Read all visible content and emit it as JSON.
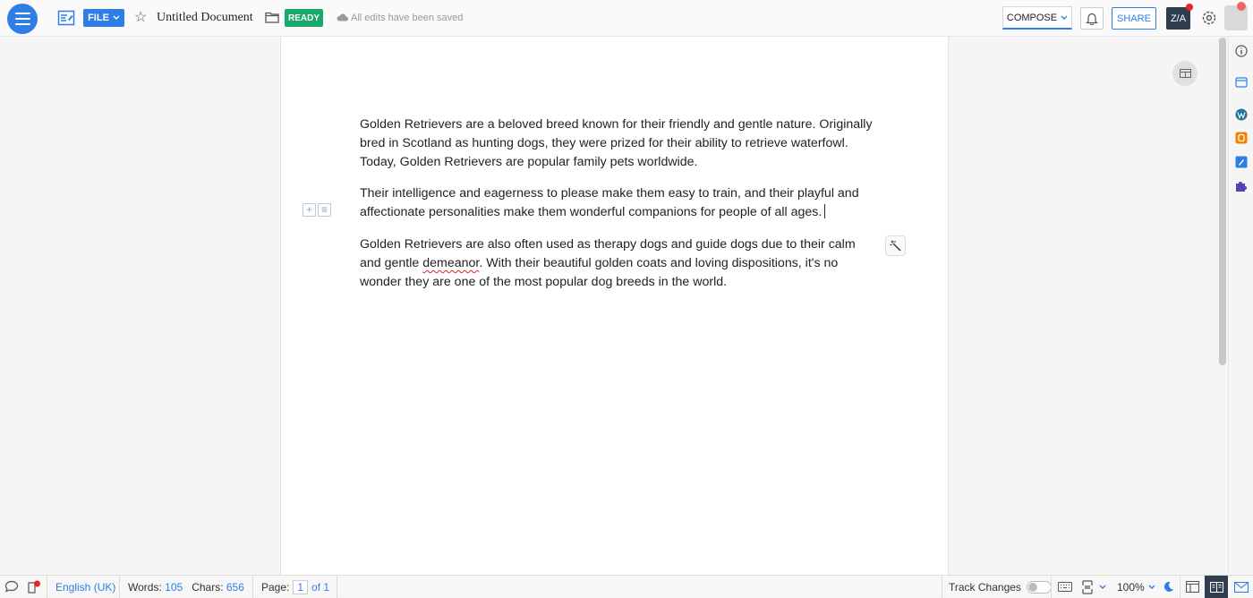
{
  "header": {
    "file_label": "FILE",
    "doc_title": "Untitled Document",
    "status_badge": "READY",
    "save_status": "All edits have been saved",
    "compose_label": "COMPOSE",
    "share_label": "SHARE",
    "translate_label": "Z/A"
  },
  "document": {
    "paragraphs": [
      "Golden Retrievers are a beloved breed known for their friendly and gentle nature. Originally bred in Scotland as hunting dogs, they were prized for their ability to retrieve waterfowl. Today, Golden Retrievers are popular family pets worldwide.",
      "Their intelligence and eagerness to please make them easy to train, and their playful and affectionate personalities make them wonderful companions for people of all ages."
    ],
    "p3_before": "Golden Retrievers are also often used as therapy dogs and guide dogs due to their calm and gentle ",
    "p3_misspelled": "demeanor",
    "p3_after": ". With their beautiful golden coats and loving dispositions, it's no wonder they are one of the most popular dog breeds in the world."
  },
  "statusbar": {
    "language": "English (UK)",
    "words_label": "Words:",
    "words_value": "105",
    "chars_label": "Chars:",
    "chars_value": "656",
    "page_label": "Page:",
    "page_current": "1",
    "page_total": "of 1",
    "track_changes_label": "Track Changes",
    "zoom": "100%"
  },
  "colors": {
    "accent": "#2f7ee6",
    "ready": "#19a96a",
    "dark": "#2f3e4e",
    "notification": "#e8242a"
  }
}
